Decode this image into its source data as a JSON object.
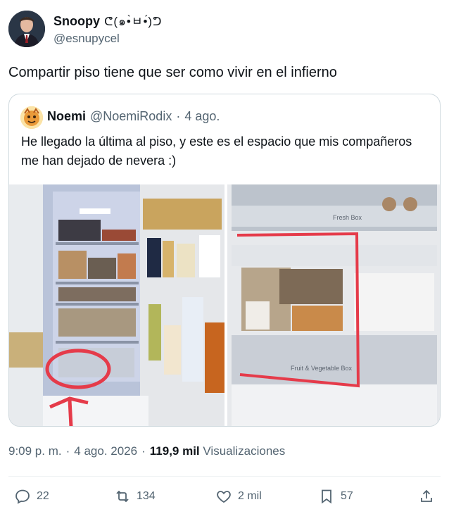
{
  "author": {
    "name": "Snoopy",
    "name_emoji": "ᕦ(๑•̀ㅂ•́)ᕤ",
    "handle": "@esnupycel"
  },
  "tweet": {
    "text": "Compartir piso tiene que ser como vivir en el infierno"
  },
  "quote": {
    "name": "Noemi",
    "handle": "@NoemiRodix",
    "separator": "·",
    "date": "4 ago.",
    "text": "He llegado la última al piso, y este es el espacio que mis compañeros me han dejado de nevera :)",
    "photo_left_icon": "fridge-photo-left",
    "photo_right_icon": "fridge-photo-right",
    "photo_text_box": "Fresh Box",
    "photo_text_drawer": "Fruit & Vegetable Box"
  },
  "meta": {
    "time": "9:09 p. m.",
    "separator": "·",
    "date": "4 ago. 2026",
    "separator2": "·",
    "views_count": "119,9 mil",
    "views_label": "Visualizaciones"
  },
  "actions": {
    "replies": "22",
    "retweets": "134",
    "likes": "2 mil",
    "bookmarks": "57"
  },
  "colors": {
    "text": "#0f1419",
    "muted": "#536471",
    "border": "#cfd9de",
    "red_mark": "#e53b4a"
  }
}
